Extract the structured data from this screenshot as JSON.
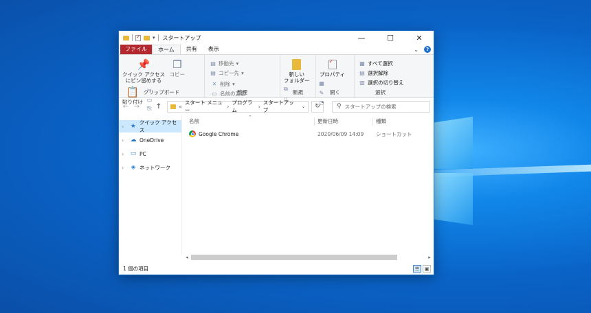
{
  "window": {
    "title": "スタートアップ",
    "controls": {
      "minimize": "—",
      "maximize": "☐",
      "close": "✕"
    }
  },
  "ribbon_tabs": [
    "ファイル",
    "ホーム",
    "共有",
    "表示"
  ],
  "ribbon": {
    "clipboard": {
      "pin_label": "クイック アクセス\nにピン留めする",
      "copy_label": "コピー",
      "paste_label": "貼り付け",
      "group_label": "クリップボード"
    },
    "organize": {
      "move_label": "移動先",
      "copy_to_label": "コピー先",
      "delete_label": "削除",
      "rename_label": "名前の変更",
      "group_label": "整理"
    },
    "new": {
      "new_folder_label": "新しい\nフォルダー",
      "group_label": "新規"
    },
    "open": {
      "properties_label": "プロパティ",
      "group_label": "開く"
    },
    "select": {
      "select_all_label": "すべて選択",
      "select_none_label": "選択解除",
      "invert_label": "選択の切り替え",
      "group_label": "選択"
    }
  },
  "address": {
    "overflow": "«",
    "crumbs": [
      "スタート メニュー",
      "プログラム",
      "スタートアップ"
    ],
    "separator": "›",
    "search_placeholder": "スタートアップの検索"
  },
  "nav_pane": [
    {
      "label": "クイック アクセス",
      "icon": "star-icon",
      "selected": true
    },
    {
      "label": "OneDrive",
      "icon": "cloud-icon"
    },
    {
      "label": "PC",
      "icon": "computer-icon"
    },
    {
      "label": "ネットワーク",
      "icon": "network-icon"
    }
  ],
  "columns": {
    "name": "名前",
    "date": "更新日時",
    "type": "種類"
  },
  "files": [
    {
      "name": "Google Chrome",
      "date": "2020/06/09 14:09",
      "type": "ショートカット",
      "icon": "chrome-icon"
    }
  ],
  "status": {
    "item_count": "1 個の項目"
  }
}
